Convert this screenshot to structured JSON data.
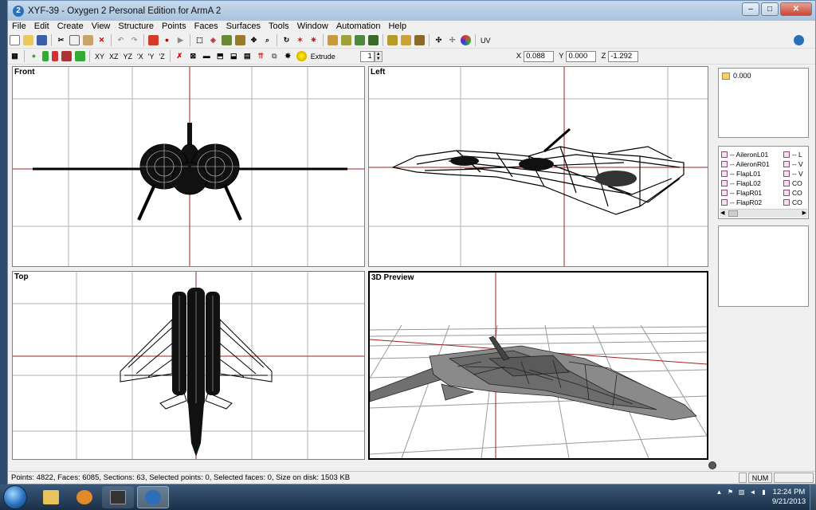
{
  "window": {
    "title": "XYF-39 - Oxygen 2 Personal Edition for ArmA 2",
    "minimize": "–",
    "maximize": "□",
    "close": "✕"
  },
  "menu": [
    "File",
    "Edit",
    "Create",
    "View",
    "Structure",
    "Points",
    "Faces",
    "Surfaces",
    "Tools",
    "Window",
    "Automation",
    "Help"
  ],
  "toolbar1": {
    "uv_label": "UV"
  },
  "toolbar2": {
    "axes": [
      "XY",
      "XZ",
      "YZ",
      "'X",
      "'Y",
      "'Z"
    ],
    "extrude_label": "Extrude",
    "extrude_value": "1",
    "x_label": "X",
    "x_value": "0.088",
    "y_label": "Y",
    "y_value": "0.000",
    "z_label": "Z",
    "z_value": "-1.292"
  },
  "viewports": {
    "front": "Front",
    "left": "Left",
    "top": "Top",
    "preview": "3D Preview"
  },
  "lod_panel": {
    "items": [
      {
        "label": "0.000"
      }
    ]
  },
  "selection_panel": {
    "items": [
      {
        "label": "-- AileronL01",
        "right": "-- L"
      },
      {
        "label": "-- AileronR01",
        "right": "-- V"
      },
      {
        "label": "-- FlapL01",
        "right": "-- V"
      },
      {
        "label": "-- FlapL02",
        "right": "CO"
      },
      {
        "label": "-- FlapR01",
        "right": "CO"
      },
      {
        "label": "-- FlapR02",
        "right": "CO"
      }
    ]
  },
  "status": {
    "text": "Points: 4822, Faces: 6085, Sections: 63, Selected points: 0, Selected faces: 0, Size on disk: 1503 KB",
    "num": "NUM"
  },
  "taskbar": {
    "time": "12:24 PM",
    "date": "9/21/2013"
  }
}
